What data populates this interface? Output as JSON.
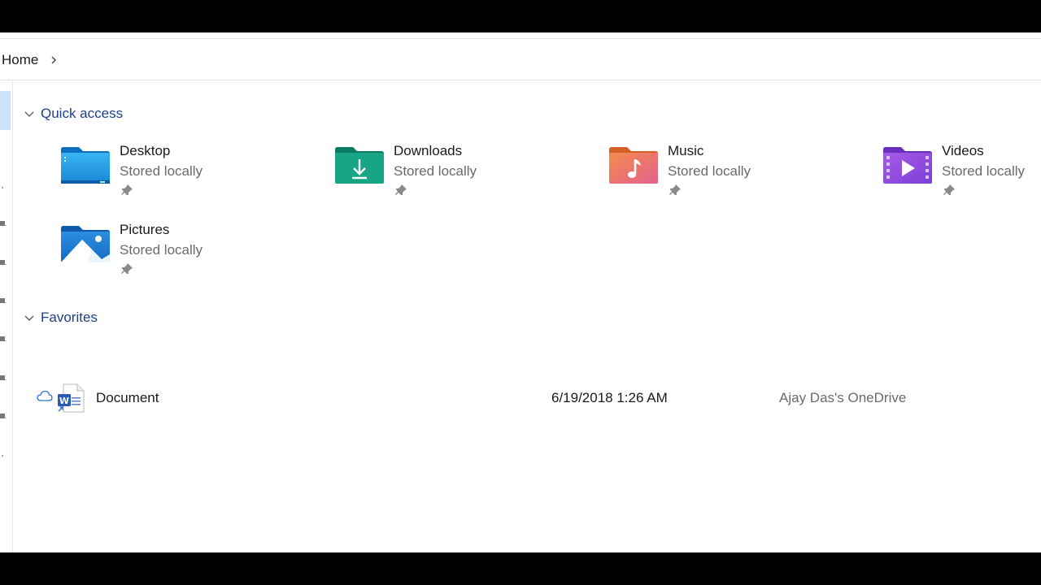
{
  "breadcrumb": {
    "home_label": "Home"
  },
  "quick_access": {
    "header": "Quick access",
    "items": [
      {
        "name": "Desktop",
        "status": "Stored locally",
        "icon": "desktop-folder-icon"
      },
      {
        "name": "Downloads",
        "status": "Stored locally",
        "icon": "downloads-folder-icon"
      },
      {
        "name": "Music",
        "status": "Stored locally",
        "icon": "music-folder-icon"
      },
      {
        "name": "Videos",
        "status": "Stored locally",
        "icon": "videos-folder-icon"
      },
      {
        "name": "Pictures",
        "status": "Stored locally",
        "icon": "pictures-folder-icon"
      }
    ]
  },
  "favorites": {
    "header": "Favorites",
    "items": [
      {
        "name": "Document",
        "date_modified": "6/19/2018 1:26 AM",
        "location": "Ajay Das's OneDrive",
        "icon": "word-document-icon",
        "status_icon": "cloud-icon"
      }
    ]
  },
  "colors": {
    "group_header": "#1d3f8a",
    "secondary_text": "#6a6a6a",
    "nav_selection": "#cfe3fb"
  }
}
